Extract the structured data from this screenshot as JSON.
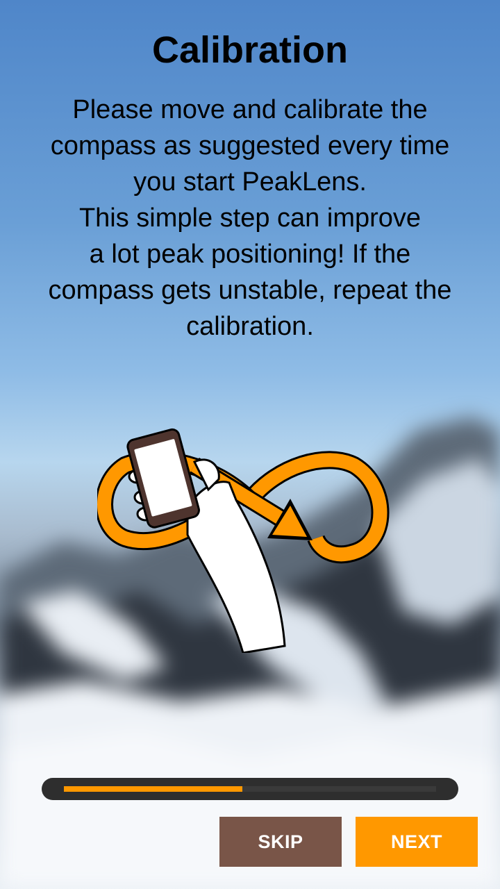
{
  "title": "Calibration",
  "description": [
    "Please move and calibrate the",
    "compass as suggested every time",
    "you start PeakLens.",
    "This simple step can improve",
    "a lot peak positioning! If the",
    "compass gets unstable, repeat the",
    "calibration."
  ],
  "progress": {
    "fraction": 0.48,
    "color": "#ff9800"
  },
  "buttons": {
    "skip": "SKIP",
    "next": "NEXT"
  },
  "colors": {
    "accent": "#ff9800",
    "skip_bg": "#795548"
  },
  "illustration": {
    "icon": "phone-figure-eight-calibration-icon"
  }
}
